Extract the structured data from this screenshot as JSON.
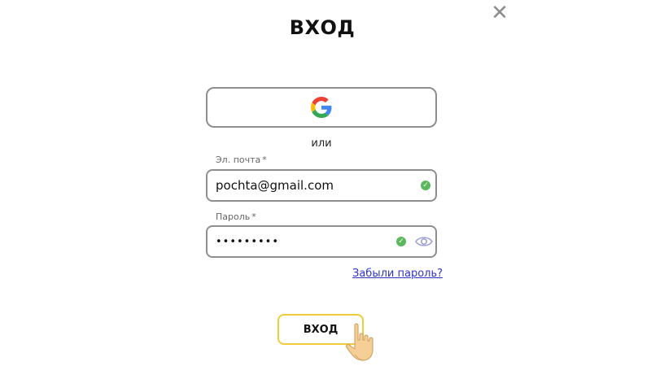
{
  "dialog": {
    "title": "ВХОД",
    "close_icon": "close-icon"
  },
  "google_button": {
    "icon": "google-icon"
  },
  "divider_text": "или",
  "email": {
    "label": "Эл. почта",
    "required_mark": "*",
    "value": "pochta@gmail.com",
    "valid_icon": "check-circle-icon"
  },
  "password": {
    "label": "Пароль",
    "required_mark": "*",
    "value": "•••••••••",
    "valid_icon": "check-circle-icon",
    "toggle_icon": "eye-icon"
  },
  "forgot_password_link": "Забыли пароль?",
  "submit": {
    "label": "ВХОД",
    "cursor_icon": "pointing-hand-icon"
  },
  "colors": {
    "accent_yellow": "#f0cc3a",
    "link_blue": "#2f33c9",
    "valid_green": "#5cb85c",
    "border_gray": "#8e8e8e"
  }
}
